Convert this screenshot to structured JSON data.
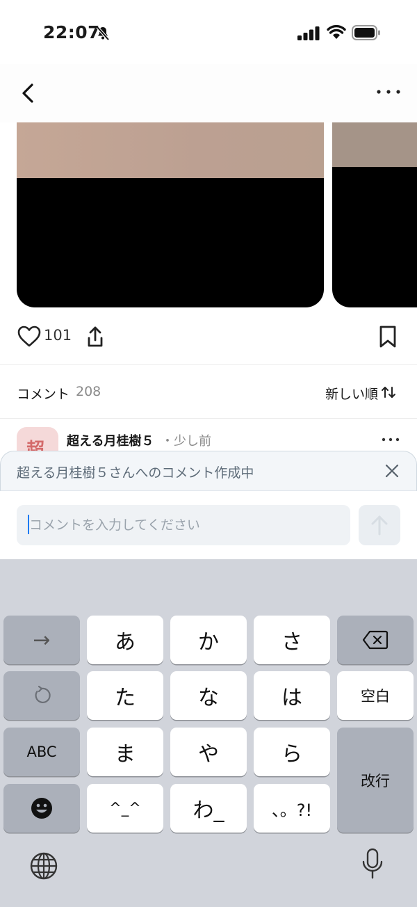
{
  "status_bar": {
    "time": "22:07"
  },
  "post": {
    "like_count": "101"
  },
  "comments": {
    "label": "コメント",
    "count": "208",
    "sort_label": "新しい順"
  },
  "comment": {
    "avatar_char": "超",
    "author": "超える月桂樹５",
    "time": "・少し前"
  },
  "reply_banner": {
    "text": "超える月桂樹５さんへのコメント作成中"
  },
  "input": {
    "placeholder": "コメントを入力してください",
    "value": ""
  },
  "keyboard": {
    "keys": {
      "arrow": "→",
      "a": "あ",
      "ka": "か",
      "sa": "さ",
      "ta": "た",
      "na": "な",
      "ha": "は",
      "space": "空白",
      "abc": "ABC",
      "ma": "ま",
      "ya": "や",
      "ra": "ら",
      "return": "改行",
      "kaomoji": "^_^",
      "wa": "わ_",
      "punct": "、。?!"
    }
  },
  "colors": {
    "accent": "#1e7cf2",
    "keyboard_bg": "#d1d4db"
  }
}
